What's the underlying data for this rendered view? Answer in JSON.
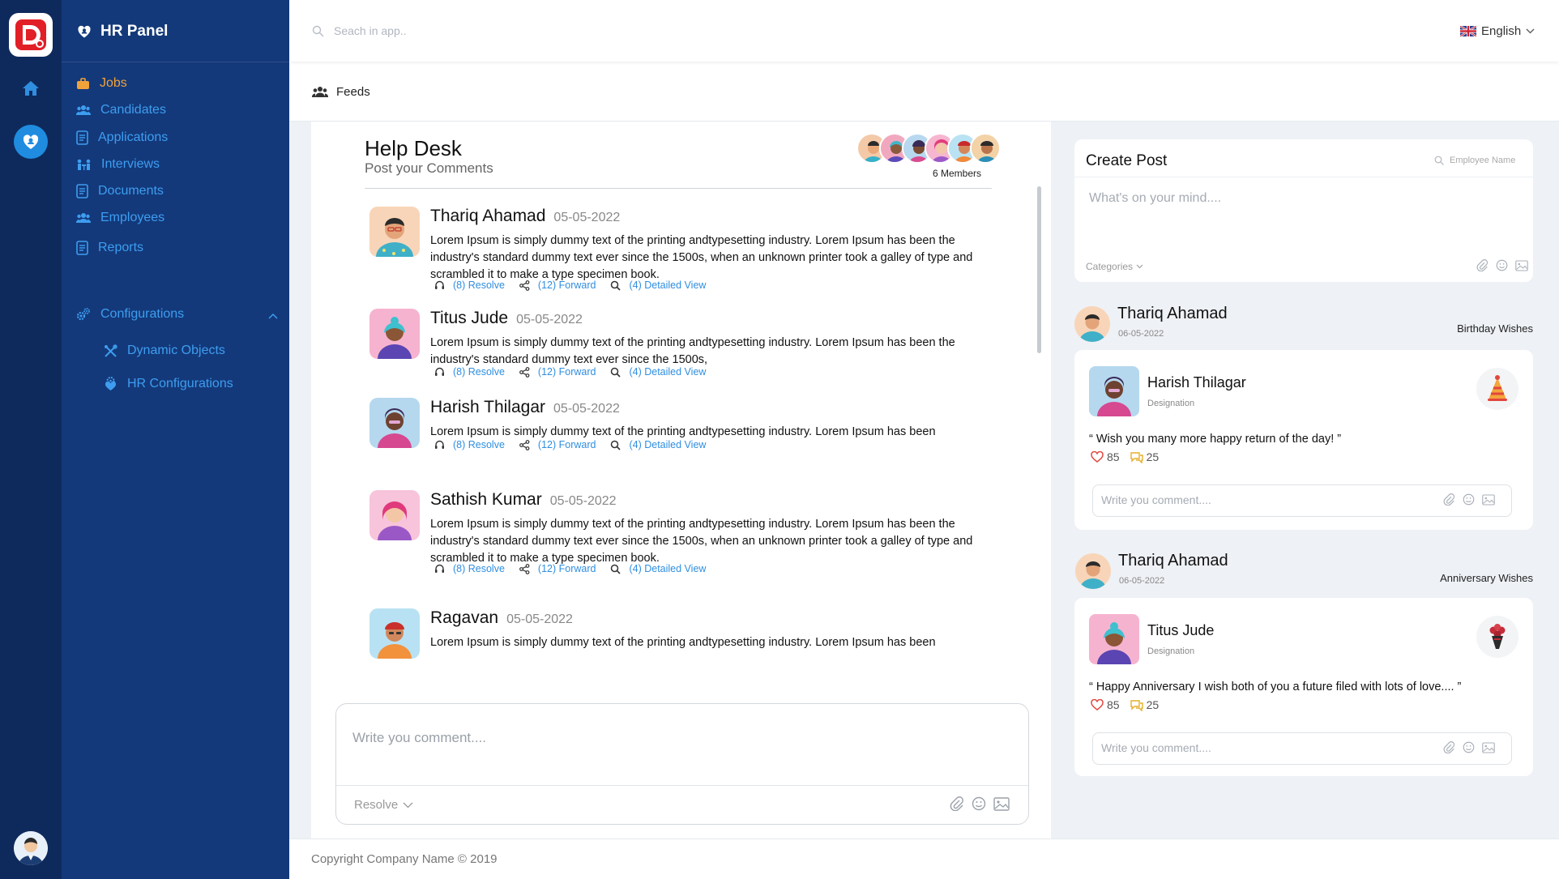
{
  "app": {
    "name": "HR Panel"
  },
  "sidebar": {
    "items": [
      {
        "label": "Jobs",
        "icon": "briefcase-icon",
        "active": true
      },
      {
        "label": "Candidates",
        "icon": "users-icon"
      },
      {
        "label": "Applications",
        "icon": "document-icon"
      },
      {
        "label": "Interviews",
        "icon": "interview-icon"
      },
      {
        "label": "Documents",
        "icon": "document-icon"
      },
      {
        "label": "Employees",
        "icon": "users-icon"
      },
      {
        "label": "Reports",
        "icon": "document-icon"
      },
      {
        "label": "Configurations",
        "icon": "gears-icon",
        "expanded": true
      },
      {
        "label": "Dynamic Objects",
        "icon": "tools-icon",
        "sub": true
      },
      {
        "label": "HR Configurations",
        "icon": "hr-config-icon",
        "sub": true
      }
    ]
  },
  "topbar": {
    "search_placeholder": "Seach in app..",
    "language": "English"
  },
  "page": {
    "title": "Feeds"
  },
  "helpdesk": {
    "title": "Help Desk",
    "subtitle": "Post your Comments",
    "members_label": "6 Members",
    "comments": [
      {
        "name": "Thariq Ahamad",
        "date": "05-05-2022",
        "text": "Lorem Ipsum is simply dummy text of the printing andtypesetting industry. Lorem Ipsum has been the industry's standard dummy text ever since the 1500s, when an unknown printer took a galley of type and scrambled it to make a type specimen book.",
        "resolve": "(8) Resolve",
        "forward": "(12) Forward",
        "detailed": "(4) Detailed View"
      },
      {
        "name": "Titus Jude",
        "date": "05-05-2022",
        "text": "Lorem Ipsum is simply dummy text of the printing andtypesetting industry. Lorem Ipsum has been the industry's standard dummy text ever since the 1500s,",
        "resolve": "(8) Resolve",
        "forward": "(12) Forward",
        "detailed": "(4) Detailed View"
      },
      {
        "name": "Harish Thilagar",
        "date": "05-05-2022",
        "text": "Lorem Ipsum is simply dummy text of the printing andtypesetting industry. Lorem Ipsum has been",
        "resolve": "(8) Resolve",
        "forward": "(12) Forward",
        "detailed": "(4) Detailed View"
      },
      {
        "name": "Sathish Kumar",
        "date": "05-05-2022",
        "text": "Lorem Ipsum is simply dummy text of the printing andtypesetting industry. Lorem Ipsum has been the industry's standard dummy text ever since the 1500s, when an unknown printer took a galley of type and scrambled it to make a type specimen book.",
        "resolve": "(8) Resolve",
        "forward": "(12) Forward",
        "detailed": "(4) Detailed View"
      },
      {
        "name": "Ragavan",
        "date": "05-05-2022",
        "text": "Lorem Ipsum is simply dummy text of the printing andtypesetting industry. Lorem Ipsum has been"
      }
    ],
    "input_placeholder": "Write you comment....",
    "resolve_dropdown": "Resolve"
  },
  "create_post": {
    "title": "Create Post",
    "employee_placeholder": "Employee Name",
    "text_placeholder": "What's on your mind....",
    "categories": "Categories"
  },
  "wishes": [
    {
      "poster": "Thariq Ahamad",
      "date": "06-05-2022",
      "type": "Birthday Wishes",
      "person": "Harish Thilagar",
      "designation": "Designation",
      "message": "“ Wish you many more happy return of the day! ”",
      "likes": "85",
      "comments": "25",
      "badge_icon": "party-hat-icon",
      "comment_placeholder": "Write you comment...."
    },
    {
      "poster": "Thariq Ahamad",
      "date": "06-05-2022",
      "type": "Anniversary Wishes",
      "person": "Titus Jude",
      "designation": "Designation",
      "message": "“ Happy Anniversary I wish both of you a future filed with lots of love.... ”",
      "likes": "85",
      "comments": "25",
      "badge_icon": "bouquet-icon",
      "comment_placeholder": "Write you comment...."
    }
  ],
  "footer": {
    "copyright": "Copyright Company Name © 2019"
  },
  "colors": {
    "rail": "#0e2a5c",
    "sidebar": "#13397a",
    "accent": "#2f8ee0",
    "active": "#f0a23b"
  }
}
